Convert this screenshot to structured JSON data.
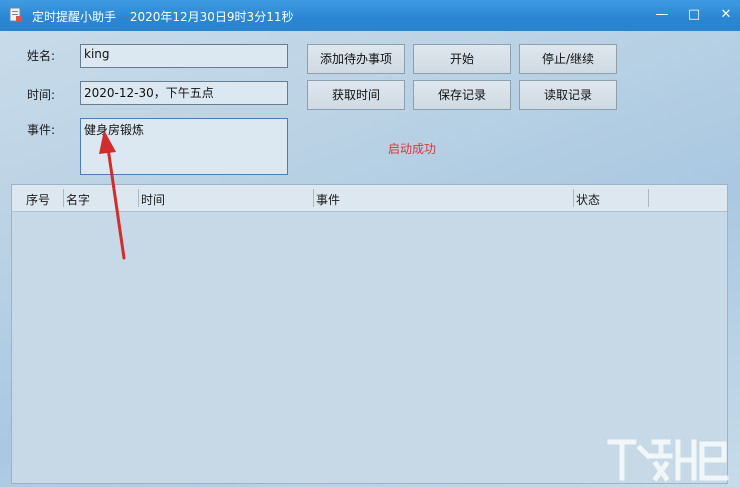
{
  "window": {
    "app_title": "定时提醒小助手",
    "clock": "2020年12月30日9时3分11秒",
    "min_symbol": "—",
    "max_symbol": "□",
    "close_symbol": "✕"
  },
  "form": {
    "name_label": "姓名:",
    "name_value": "king",
    "time_label": "时间:",
    "time_value": "2020-12-30，下午五点",
    "event_label": "事件:",
    "event_value": "健身房锻炼"
  },
  "buttons": {
    "add_todo": "添加待办事项",
    "start": "开始",
    "stop_resume": "停止/继续",
    "get_time": "获取时间",
    "save_record": "保存记录",
    "read_record": "读取记录"
  },
  "status_text": "启动成功",
  "table": {
    "columns": [
      "序号",
      "名字",
      "时间",
      "事件",
      "状态"
    ],
    "rows": []
  },
  "colors": {
    "titlebar": "#2a86d4",
    "status_text": "#d83a3a",
    "arrow": "#d32c2c"
  }
}
